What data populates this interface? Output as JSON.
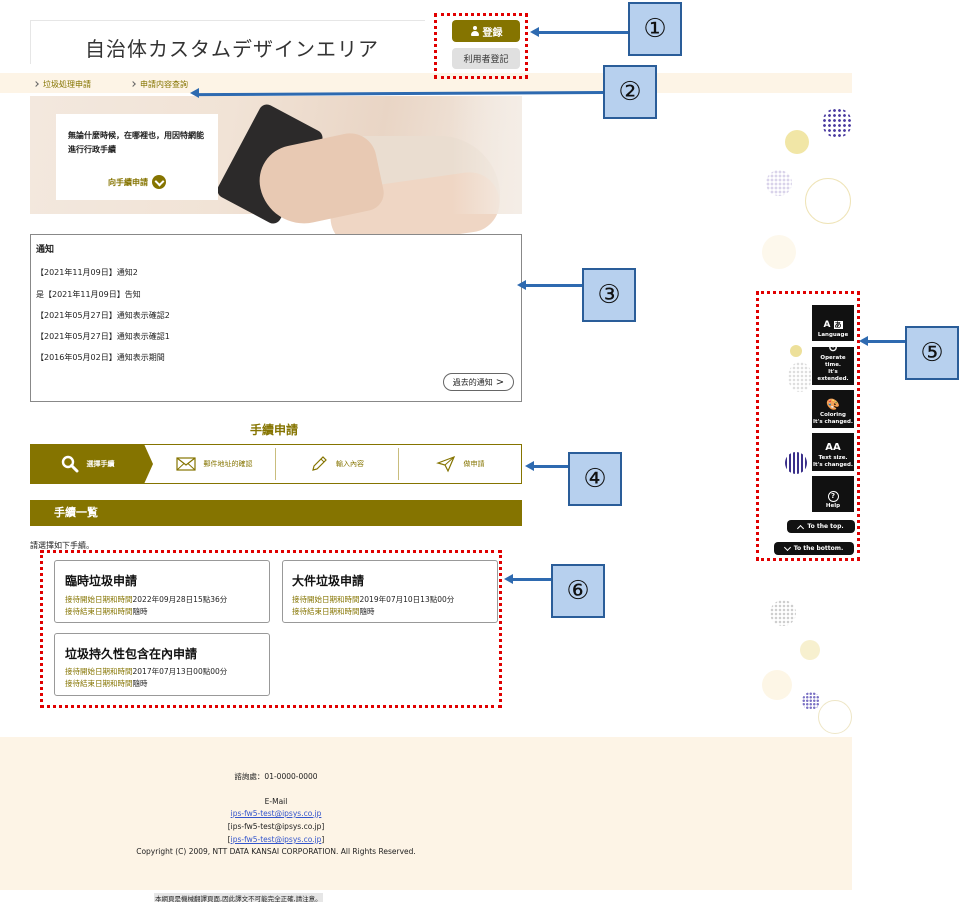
{
  "header": {
    "brand_title": "自治体カスタムデザインエリア",
    "login_label": "登録",
    "register_label": "利用者登記"
  },
  "nav": {
    "items": [
      "垃圾処理申請",
      "申請内容查詢"
    ]
  },
  "hero": {
    "line1": "無論什麼時候，在哪裡也，用因特網能",
    "line2": "進行行政手續",
    "cta": "向手續申請"
  },
  "notice": {
    "title": "通知",
    "items": [
      "【2021年11月09日】通知2",
      "是【2021年11月09日】告知",
      "【2021年05月27日】通知表示確認2",
      "【2021年05月27日】通知表示確認1",
      "【2016年05月02日】通知表示期間"
    ],
    "past_button": "過去的通知"
  },
  "procedure": {
    "title": "手續申請",
    "steps": [
      "選擇手續",
      "郵件地址的確認",
      "輸入內容",
      "做申請"
    ]
  },
  "list": {
    "header": "手續一覧",
    "instruction": "請選擇如下手續。",
    "start_label": "接待開始日期和時間",
    "end_label": "接待結束日期和時間",
    "cards": [
      {
        "title": "臨時垃圾申請",
        "start": "2022年09月28日15點36分",
        "end": "隨時"
      },
      {
        "title": "大件垃圾申請",
        "start": "2019年07月10日13點00分",
        "end": "隨時"
      },
      {
        "title": "垃圾持久性包含在內申請",
        "start": "2017年07月13日00點00分",
        "end": "隨時"
      }
    ]
  },
  "footer": {
    "contact": "諮詢處：01-0000-0000",
    "email_label": "E-Mail",
    "email1": "ips-fw5-test@ipsys.co.jp",
    "email2": "[ips-fw5-test@ipsys.co.jp]",
    "email3_prefix": "[",
    "email3": "ips-fw5-test@ipsys.co.jp",
    "email3_suffix": "]",
    "copyright": "Copyright (C) 2009, NTT DATA KANSAI CORPORATION. All Rights Reserved.",
    "machine_translation_note": "本網頁是機械翻譯頁面,因此譯文不可能完全正確,請注意。"
  },
  "side_toolbar": {
    "language": "Language",
    "operate_time_1": "Operate time.",
    "operate_time_2": "It's extended.",
    "coloring_1": "Coloring",
    "coloring_2": "It's changed.",
    "text_size_1": "Text size.",
    "text_size_2": "It's changed.",
    "help": "Help",
    "to_top": "To the top.",
    "to_bottom": "To the bottom.",
    "text_size_glyph": "AA",
    "language_glyph_a": "A",
    "language_glyph_b": "あ"
  },
  "annotations": [
    "①",
    "②",
    "③",
    "④",
    "⑤",
    "⑥"
  ],
  "colors": {
    "brand": "#857400",
    "nav_bg": "#fdf4e6",
    "annotation_red": "#e00000",
    "callout_fill": "#b7d0ee",
    "callout_border": "#2a5d99"
  }
}
